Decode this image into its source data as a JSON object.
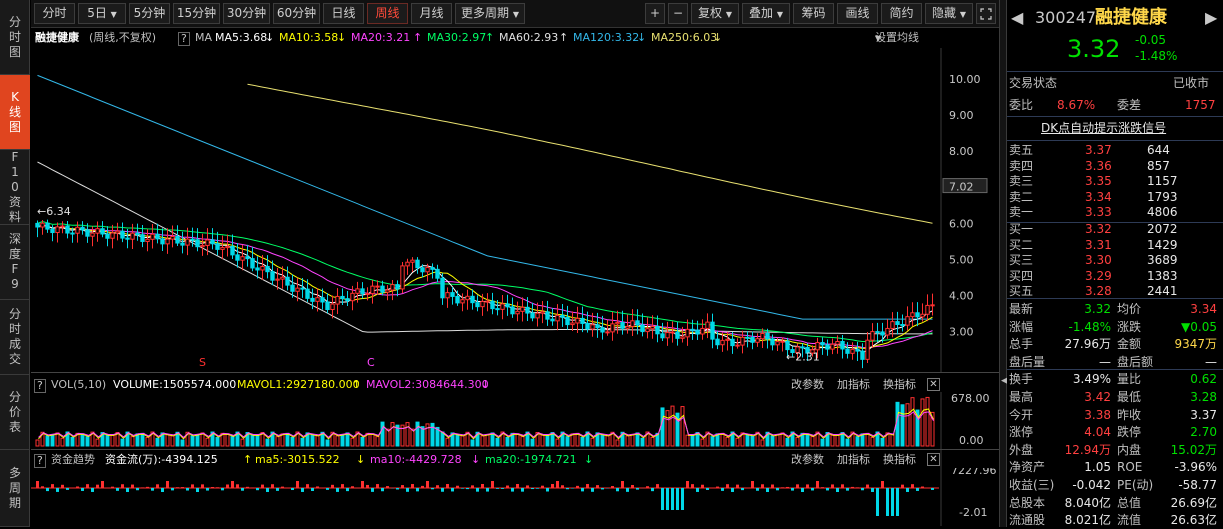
{
  "left_nav": [
    {
      "label": "分时图"
    },
    {
      "label": "K线图",
      "active": true
    },
    {
      "label": "F10资料"
    },
    {
      "label": "深度F9"
    },
    {
      "label": "分时成交"
    },
    {
      "label": "分价表"
    },
    {
      "label": "多周期"
    }
  ],
  "toolbar": {
    "periods": [
      "分时",
      "5日",
      "5分钟",
      "15分钟",
      "30分钟",
      "60分钟",
      "日线",
      "周线",
      "月线",
      "更多周期"
    ],
    "active_period": "周线",
    "tools": [
      "+",
      "−",
      "复权",
      "叠加",
      "筹码",
      "画线",
      "简约",
      "隐藏"
    ]
  },
  "ma_line": {
    "name": "融捷健康",
    "mode": "(周线,不复权)",
    "help": "?",
    "ma_label": "MA",
    "ma5": "MA5:3.68",
    "ma10": "MA10:3.58",
    "ma20": "MA20:3.21",
    "ma30": "MA30:2.97",
    "ma60": "MA60:2.93",
    "ma120": "MA120:3.32",
    "ma250": "MA250:6.03",
    "settings": "设置均线"
  },
  "kline": {
    "yaxis": [
      "10.00",
      "9.00",
      "8.00",
      "7.02",
      "6.00",
      "5.00",
      "4.00",
      "3.00"
    ],
    "current_marker": "7.02",
    "high_label": "6.34",
    "low_label": "2.31",
    "markers": [
      "S",
      "C"
    ]
  },
  "vol_panel": {
    "name": "VOL(5,10)",
    "volume": "VOLUME:1505574.000",
    "mavol1": "MAVOL1:2927180.000",
    "mavol2": "MAVOL2:3084644.300",
    "buttons": [
      "改参数",
      "加指标",
      "换指标"
    ],
    "yaxis": [
      "678.00",
      "0.00"
    ]
  },
  "fund_panel": {
    "name": "资金趋势",
    "flow": "资金流(万):-4394.125",
    "ma5": "ma5:-3015.522",
    "ma10": "ma10:-4429.728",
    "ma20": "ma20:-1974.721",
    "buttons": [
      "改参数",
      "加指标",
      "换指标"
    ],
    "yaxis": [
      "7227.96",
      "-2.01"
    ]
  },
  "quote": {
    "code": "300247",
    "name": "融捷健康",
    "price": "3.32",
    "change": "-0.05",
    "change_pct": "-1.48%",
    "status_label": "交易状态",
    "status": "已收市",
    "weibi_label": "委比",
    "weibi": "8.67%",
    "weicha_label": "委差",
    "weicha": "1757",
    "dk_banner": "DK点自动提示涨跌信号",
    "asks": [
      {
        "label": "卖五",
        "price": "3.37",
        "vol": "644"
      },
      {
        "label": "卖四",
        "price": "3.36",
        "vol": "857"
      },
      {
        "label": "卖三",
        "price": "3.35",
        "vol": "1157"
      },
      {
        "label": "卖二",
        "price": "3.34",
        "vol": "1793"
      },
      {
        "label": "卖一",
        "price": "3.33",
        "vol": "4806"
      }
    ],
    "bids": [
      {
        "label": "买一",
        "price": "3.32",
        "vol": "2072"
      },
      {
        "label": "买二",
        "price": "3.31",
        "vol": "1429"
      },
      {
        "label": "买三",
        "price": "3.30",
        "vol": "3689"
      },
      {
        "label": "买四",
        "price": "3.29",
        "vol": "1383"
      },
      {
        "label": "买五",
        "price": "3.28",
        "vol": "2441"
      }
    ],
    "stats": [
      {
        "l1": "最新",
        "v1": "3.32",
        "c1": "grn",
        "l2": "均价",
        "v2": "3.34",
        "c2": "red"
      },
      {
        "l1": "涨幅",
        "v1": "-1.48%",
        "c1": "grn",
        "l2": "涨跌",
        "v2": "▼0.05",
        "c2": "grn"
      },
      {
        "l1": "总手",
        "v1": "27.96万",
        "c1": "wht",
        "l2": "金额",
        "v2": "9347万",
        "c2": "yel"
      },
      {
        "l1": "盘后量",
        "v1": "—",
        "c1": "wht",
        "l2": "盘后额",
        "v2": "—",
        "c2": "wht"
      },
      {
        "l1": "换手",
        "v1": "3.49%",
        "c1": "wht",
        "l2": "量比",
        "v2": "0.62",
        "c2": "grn"
      },
      {
        "l1": "最高",
        "v1": "3.42",
        "c1": "red",
        "l2": "最低",
        "v2": "3.28",
        "c2": "grn"
      },
      {
        "l1": "今开",
        "v1": "3.38",
        "c1": "red",
        "l2": "昨收",
        "v2": "3.37",
        "c2": "wht"
      },
      {
        "l1": "涨停",
        "v1": "4.04",
        "c1": "red",
        "l2": "跌停",
        "v2": "2.70",
        "c2": "grn"
      },
      {
        "l1": "外盘",
        "v1": "12.94万",
        "c1": "red",
        "l2": "内盘",
        "v2": "15.02万",
        "c2": "grn"
      },
      {
        "l1": "净资产",
        "v1": "1.05",
        "c1": "wht",
        "l2": "ROE",
        "v2": "-3.96%",
        "c2": "wht"
      },
      {
        "l1": "收益(三)",
        "v1": "-0.042",
        "c1": "wht",
        "l2": "PE(动)",
        "v2": "-58.77",
        "c2": "wht"
      },
      {
        "l1": "总股本",
        "v1": "8.040亿",
        "c1": "wht",
        "l2": "总值",
        "v2": "26.69亿",
        "c2": "wht"
      },
      {
        "l1": "流通股",
        "v1": "8.021亿",
        "c1": "wht",
        "l2": "流值",
        "v2": "26.63亿",
        "c2": "wht"
      }
    ]
  },
  "colors": {
    "up": "#ff3030",
    "down": "#00d8e8",
    "ma5": "#ffffff",
    "ma10": "#ffff00",
    "ma20": "#ff44ff",
    "ma30": "#00ff66",
    "ma120": "#33b7e8",
    "ma250": "#e8e070",
    "active": "#e0451f"
  }
}
